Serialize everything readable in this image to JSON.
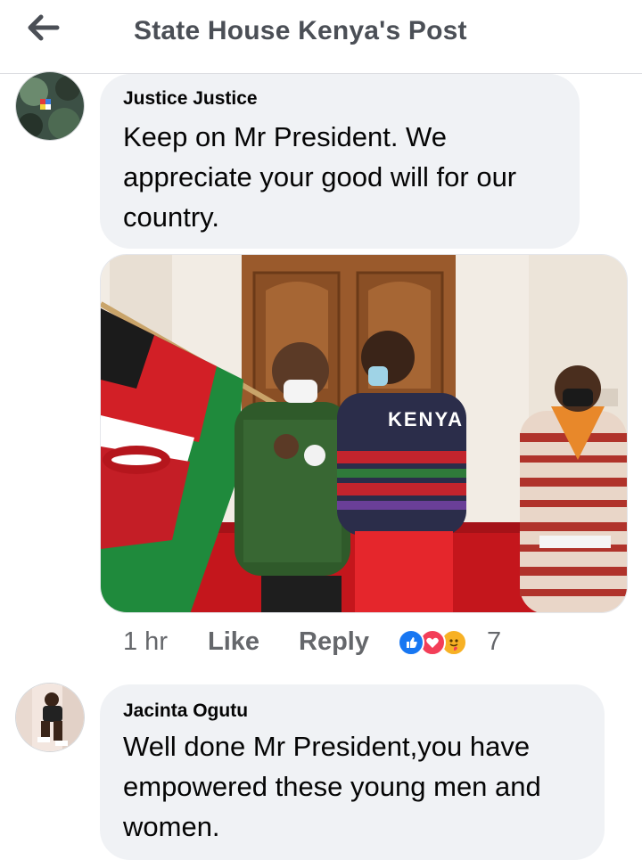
{
  "header": {
    "title": "State House Kenya's Post",
    "back_icon": "arrow-left-icon"
  },
  "comments": [
    {
      "author": "Justice Justice",
      "text_lines": [
        "Keep on Mr President. We",
        "appreciate your good will for our",
        "country."
      ],
      "has_photo": true,
      "photo_text": "KENYA",
      "time": "1 hr",
      "like_label": "Like",
      "reply_label": "Reply",
      "reaction_icons": [
        "like-reaction-icon",
        "love-reaction-icon",
        "care-reaction-icon"
      ],
      "reaction_count": "7"
    },
    {
      "author": "Jacinta Ogutu",
      "text_lines": [
        "Well done Mr President,you have",
        "empowered these young men and",
        "women."
      ]
    }
  ],
  "colors": {
    "bubble": "#f0f2f5",
    "meta_text": "#65676b",
    "like_blue": "#1877f2",
    "love_red": "#f33e58",
    "care_yellow": "#f7b125"
  }
}
